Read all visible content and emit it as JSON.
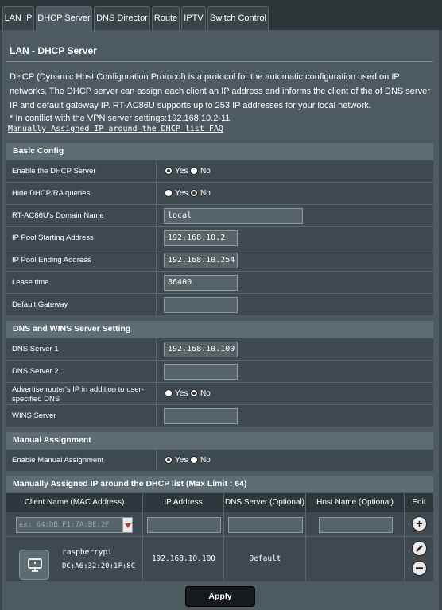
{
  "tabs": [
    {
      "label": "LAN IP"
    },
    {
      "label": "DHCP Server"
    },
    {
      "label": "DNS Director"
    },
    {
      "label": "Route"
    },
    {
      "label": "IPTV"
    },
    {
      "label": "Switch Control"
    }
  ],
  "page": {
    "title": "LAN - DHCP Server",
    "description": "DHCP (Dynamic Host Configuration Protocol) is a protocol for the automatic configuration used on IP networks. The DHCP server can assign each client an IP address and informs the client of the of DNS server IP and default gateway IP. RT-AC86U supports up to 253 IP addresses for your local network.",
    "conflict_note": "* In conflict with the VPN server settings:192.168.10.2-11",
    "faq_link": "Manually Assigned IP around the DHCP list FAQ"
  },
  "basic": {
    "header": "Basic Config",
    "enable_dhcp": {
      "label": "Enable the DHCP Server",
      "yes": "Yes",
      "no": "No",
      "selected": "Yes"
    },
    "hide_dhcp": {
      "label": "Hide DHCP/RA queries",
      "yes": "Yes",
      "no": "No",
      "selected": "No"
    },
    "domain": {
      "label": "RT-AC86U's Domain Name",
      "value": "local"
    },
    "pool_start": {
      "label": "IP Pool Starting Address",
      "value": "192.168.10.2"
    },
    "pool_end": {
      "label": "IP Pool Ending Address",
      "value": "192.168.10.254"
    },
    "lease": {
      "label": "Lease time",
      "value": "86400"
    },
    "gateway": {
      "label": "Default Gateway",
      "value": ""
    }
  },
  "dns": {
    "header": "DNS and WINS Server Setting",
    "dns1": {
      "label": "DNS Server 1",
      "value": "192.168.10.100"
    },
    "dns2": {
      "label": "DNS Server 2",
      "value": ""
    },
    "advertise": {
      "label": "Advertise router's IP in addition to user-specified DNS",
      "yes": "Yes",
      "no": "No",
      "selected": "No"
    },
    "wins": {
      "label": "WINS Server",
      "value": ""
    }
  },
  "manual": {
    "header": "Manual Assignment",
    "enable": {
      "label": "Enable Manual Assignment",
      "yes": "Yes",
      "no": "No",
      "selected": "Yes"
    }
  },
  "list": {
    "header": "Manually Assigned IP around the DHCP list (Max Limit : 64)",
    "columns": [
      "Client Name (MAC Address)",
      "IP Address",
      "DNS Server (Optional)",
      "Host Name (Optional)",
      "Edit"
    ],
    "new_row": {
      "mac_placeholder": "ex: 64:DB:F1:7A:BE:2F"
    },
    "entries": [
      {
        "name": "raspberrypi",
        "mac": "DC:A6:32:20:1F:8C",
        "ip": "192.168.10.100",
        "dns": "Default",
        "host": ""
      }
    ]
  },
  "apply_label": "Apply",
  "colors": {
    "background": "#3b474c",
    "panel": "#4d5a5f",
    "section": "#5e6d72",
    "row": "#3e4a4f"
  }
}
